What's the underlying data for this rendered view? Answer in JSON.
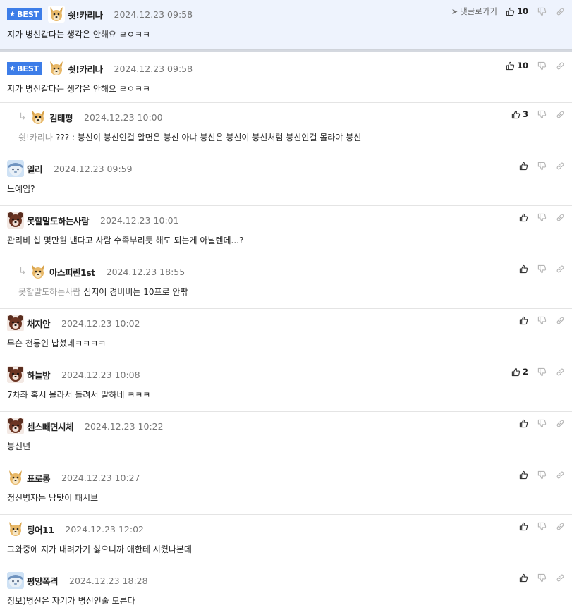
{
  "labels": {
    "best": "BEST",
    "reply_button": "댓글로가기"
  },
  "colors": {
    "best_badge": "#3d7de8",
    "best_background": "#eef3fd",
    "mention": "#999999"
  },
  "comments": [
    {
      "nick": "쉿!카리나",
      "date": "2024.12.23 09:58",
      "text": "지가 병신같다는 생각은 안해요 ㄹㅇㅋㅋ",
      "likes": "10",
      "best": true,
      "avatar": "dog"
    },
    {
      "nick": "쉿!카리나",
      "date": "2024.12.23 09:58",
      "text": "지가 병신같다는 생각은 안해요 ㄹㅇㅋㅋ",
      "likes": "10",
      "best": true,
      "avatar": "dog"
    },
    {
      "nick": "김태평",
      "date": "2024.12.23 10:00",
      "mention": "쉿!카리나",
      "text": "??? : 붕신이 붕신인걸 알면은 붕신 아냐 붕신은 붕신이 붕신처럼 붕신인걸 몰라야 붕신",
      "likes": "3",
      "reply": true,
      "avatar": "dog"
    },
    {
      "nick": "일리",
      "date": "2024.12.23 09:59",
      "text": "노예임?",
      "likes": "",
      "avatar": "blue"
    },
    {
      "nick": "못할말도하는사람",
      "date": "2024.12.23 10:01",
      "text": "관리비 십 몇만원 낸다고 사람 수족부리듯 해도 되는게 아닐텐데...?",
      "likes": "",
      "avatar": "bear"
    },
    {
      "nick": "아스피린1st",
      "date": "2024.12.23 18:55",
      "mention": "못할말도하는사람",
      "text": "심지어 경비비는 10프로 안팎",
      "likes": "",
      "reply": true,
      "avatar": "dog"
    },
    {
      "nick": "채지안",
      "date": "2024.12.23 10:02",
      "text": "무슨 천룡인 납셨네ㅋㅋㅋㅋ",
      "likes": "",
      "avatar": "bear"
    },
    {
      "nick": "하늘밤",
      "date": "2024.12.23 10:08",
      "text": "7차좌 혹시 몰라서 돌려서 말하네 ㅋㅋㅋ",
      "likes": "2",
      "avatar": "bear"
    },
    {
      "nick": "센스빼면시체",
      "date": "2024.12.23 10:22",
      "text": "붕신년",
      "likes": "",
      "avatar": "bear"
    },
    {
      "nick": "표로롱",
      "date": "2024.12.23 10:27",
      "text": "정신병자는 남탓이 패시브",
      "likes": "",
      "avatar": "dog"
    },
    {
      "nick": "팅어11",
      "date": "2024.12.23 12:02",
      "text": "그와중에 지가 내려가기 싫으니까 애한테 시켰나본데",
      "likes": "",
      "avatar": "dog"
    },
    {
      "nick": "평양폭격",
      "date": "2024.12.23 18:28",
      "text": "정보)병신은 자기가 병신인줄 모른다",
      "likes": "",
      "avatar": "blue"
    }
  ]
}
